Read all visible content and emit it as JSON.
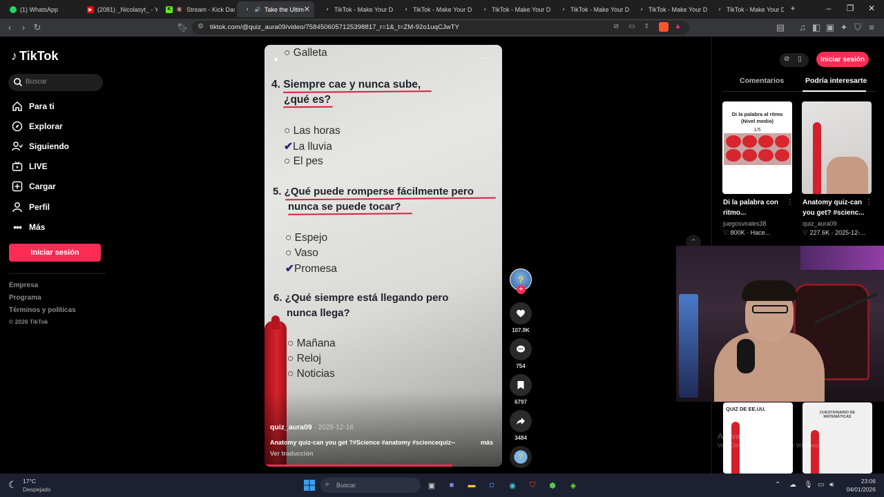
{
  "browser": {
    "tabs": [
      {
        "label": "(1) WhatsApp",
        "color": "#25d366"
      },
      {
        "label": "(2081) _Nicolasyt_ - Yo",
        "color": "#ff0000"
      },
      {
        "label": "Stream - Kick Dash",
        "color": "#53fc18"
      },
      {
        "label": "Take the Ultim",
        "color": "#ffffff",
        "active": true
      },
      {
        "label": "TikTok - Make Your Da",
        "color": "#ffffff"
      },
      {
        "label": "TikTok - Make Your Da",
        "color": "#ffffff"
      },
      {
        "label": "TikTok - Make Your Da",
        "color": "#ffffff"
      },
      {
        "label": "TikTok - Make Your Da",
        "color": "#ffffff"
      },
      {
        "label": "TikTok - Make Your Da",
        "color": "#ffffff"
      },
      {
        "label": "TikTok - Make Your Da",
        "color": "#ffffff"
      }
    ],
    "new_tab": "+",
    "url": "tiktok.com/@quiz_aura09/video/7584506057125398817_r=1&_t=ZM-92o1uqCJwTY"
  },
  "sidebar": {
    "logo": "TikTok",
    "search_placeholder": "Buscar",
    "nav": [
      {
        "label": "Para ti",
        "icon": "home-icon"
      },
      {
        "label": "Explorar",
        "icon": "compass-icon"
      },
      {
        "label": "Siguiendo",
        "icon": "following-icon"
      },
      {
        "label": "LIVE",
        "icon": "live-icon"
      },
      {
        "label": "Cargar",
        "icon": "upload-icon"
      },
      {
        "label": "Perfil",
        "icon": "profile-icon"
      },
      {
        "label": "Más",
        "icon": "more-icon"
      }
    ],
    "login": "Iniciar sesión",
    "footer": [
      "Empresa",
      "Programa",
      "Términos y políticas",
      "© 2026 TikTok"
    ]
  },
  "video": {
    "lines": {
      "galleta": "Galleta",
      "q4a": "4. Siempre cae y nunca sube,",
      "q4b": "¿qué es?",
      "q4o1": "Las horas",
      "q4o2": "La lluvia",
      "q4o3": "El pes",
      "q5a": "5. ¿Qué puede romperse fácilmente pero",
      "q5b": "nunca se puede tocar?",
      "q5o1": "Espejo",
      "q5o2": "Vaso",
      "q5o3": "Promesa",
      "q6a": "6. ¿Qué siempre está llegando pero",
      "q6b": "nunca llega?",
      "q6o1": "Mañana",
      "q6o2": "Reloj",
      "q6o3": "Noticias"
    },
    "author": "quiz_aura09",
    "date": "· 2025-12-16",
    "caption": "Anatomy quiz-can you get ?#Science #anatomy #sciencequiz--",
    "more": "más",
    "translate": "Ver traducción",
    "progress": 0.79
  },
  "actions": {
    "likes": "107.9K",
    "comments": "754",
    "saves": "6797",
    "shares": "3484"
  },
  "right": {
    "login": "Iniciar sesión",
    "tab_comments": "Comentarios",
    "tab_related": "Podría interesarte",
    "cards": [
      {
        "title": "Di la palabra con ritmo...",
        "author": "juegosvirales38",
        "stats": "800K · Hace...",
        "thumb_text": "Di la palabra al ritmo (Nivel medio)",
        "thumb_sub": "1/5"
      },
      {
        "title": "Anatomy quiz-can you get? #scienc...",
        "author": "quiz_aura09",
        "stats": "227.6K · 2025-12-..."
      }
    ],
    "bottom_thumbs": [
      "QUIZ DE EE.UU.",
      "CUESTIONARIO DE MATEMÁTICAS"
    ],
    "watermark": "Activar Windows",
    "watermark_sub": "Ve a Configuración para activar Windows."
  },
  "taskbar": {
    "weather_temp": "17°C",
    "weather_desc": "Despejado",
    "search_placeholder": "Buscar",
    "time": "23:06",
    "date": "04/01/2026"
  }
}
